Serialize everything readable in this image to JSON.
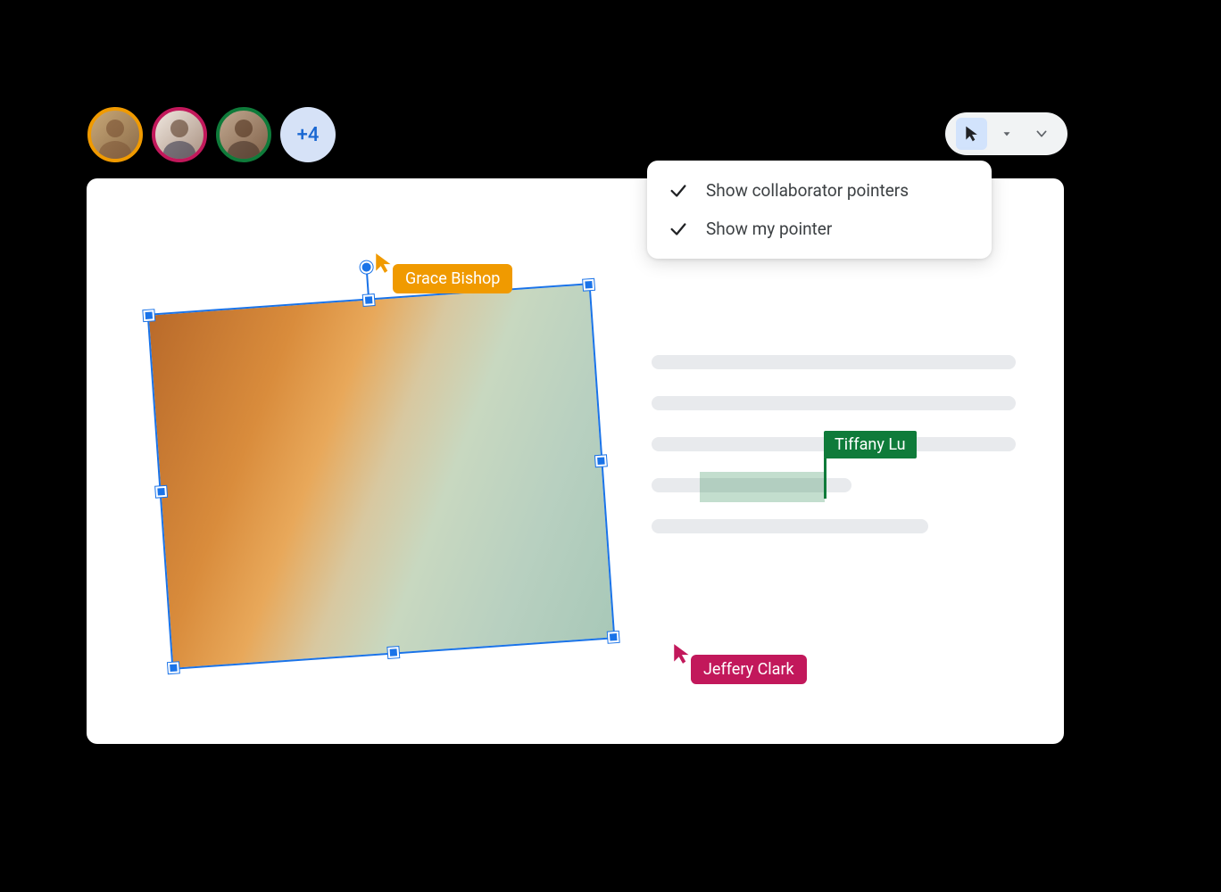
{
  "collaborators": {
    "overflow_count": "+4",
    "avatars": [
      {
        "ring_color": "#F09A00"
      },
      {
        "ring_color": "#C2185B"
      },
      {
        "ring_color": "#0F7B3A"
      }
    ]
  },
  "toolbar": {
    "cursor_button_active": true
  },
  "dropdown": {
    "items": [
      {
        "checked": true,
        "label": "Show collaborator pointers"
      },
      {
        "checked": true,
        "label": "Show my pointer"
      }
    ]
  },
  "pointers": {
    "grace": {
      "name": "Grace Bishop",
      "color": "#F09A00"
    },
    "jeffery": {
      "name": "Jeffery Clark",
      "color": "#C2185B"
    },
    "tiffany": {
      "name": "Tiffany Lu",
      "color": "#0F7B3A"
    }
  }
}
